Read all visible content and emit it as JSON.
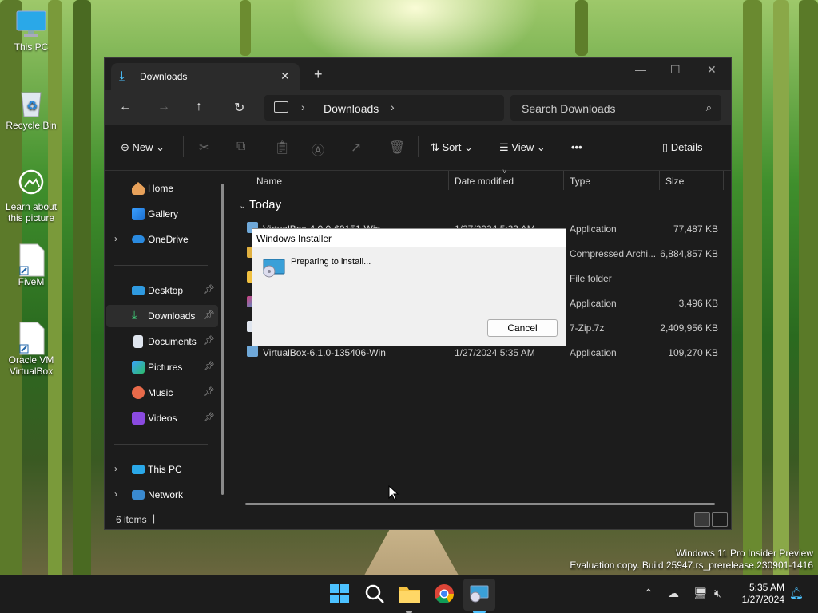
{
  "desktop": {
    "icons": [
      {
        "label": "This PC"
      },
      {
        "label": "Recycle Bin"
      },
      {
        "label": "Learn about this picture"
      },
      {
        "label": "FiveM"
      },
      {
        "label": "Oracle VM VirtualBox"
      }
    ]
  },
  "explorer": {
    "tab_title": "Downloads",
    "address_crumb": "Downloads",
    "search_placeholder": "Search Downloads",
    "toolbar": {
      "new_label": "New",
      "sort_label": "Sort",
      "view_label": "View",
      "more_label": "•••",
      "details_label": "Details"
    },
    "sidebar": {
      "home": "Home",
      "gallery": "Gallery",
      "onedrive": "OneDrive",
      "desktop": "Desktop",
      "downloads": "Downloads",
      "documents": "Documents",
      "pictures": "Pictures",
      "music": "Music",
      "videos": "Videos",
      "thispc": "This PC",
      "network": "Network"
    },
    "columns": {
      "name": "Name",
      "date": "Date modified",
      "type": "Type",
      "size": "Size"
    },
    "group": "Today",
    "rows": [
      {
        "name": "VirtualBox-4.0.0-69151-Win",
        "date": "1/27/2024 5:33 AM",
        "type": "Application",
        "size": "77,487 KB"
      },
      {
        "name": "",
        "date": "",
        "type": "Compressed Archi...",
        "size": "6,884,857 KB"
      },
      {
        "name": "",
        "date": "",
        "type": "File folder",
        "size": ""
      },
      {
        "name": "",
        "date": "",
        "type": "Application",
        "size": "3,496 KB"
      },
      {
        "name": "",
        "date": "",
        "type": "7-Zip.7z",
        "size": "2,409,956 KB"
      },
      {
        "name": "VirtualBox-6.1.0-135406-Win",
        "date": "1/27/2024 5:35 AM",
        "type": "Application",
        "size": "109,270 KB"
      }
    ],
    "status": "6 items",
    "status_caret": "|"
  },
  "installer_dialog": {
    "title": "Windows Installer",
    "message": "Preparing to install...",
    "cancel_label": "Cancel"
  },
  "watermark": {
    "line1": "Windows 11 Pro Insider Preview",
    "line2": "Evaluation copy. Build 25947.rs_prerelease.230901-1416"
  },
  "taskbar": {
    "time": "5:35 AM",
    "date": "1/27/2024"
  },
  "colors": {
    "accent": "#4cc2ff",
    "explorer_bg": "#1c1c1c",
    "taskbar_bg": "#1c1c1c"
  }
}
